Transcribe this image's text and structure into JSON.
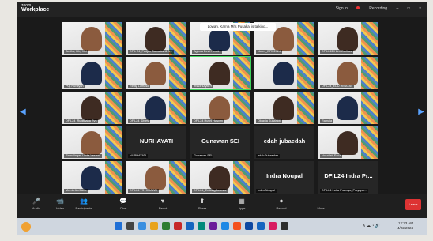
{
  "app": {
    "brand_small": "zoom",
    "brand_main": "Workplace"
  },
  "topbar": {
    "signin": "Sign in",
    "recording": "Recording"
  },
  "speaking_banner": "Lowan, Karna Mi's Pusakal is talking...",
  "tiles": [
    {
      "label": "Bertha, Liby Ltd",
      "type": "video"
    },
    {
      "label": "DFIL 24_Fadjan Tsanadamit A...",
      "type": "video"
    },
    {
      "label": "Aghnia Dewi Hendri",
      "type": "video"
    },
    {
      "label": "Nores_DFIL2024",
      "type": "video"
    },
    {
      "label": "DFIL2424 Leri Darlitas",
      "type": "video"
    },
    {
      "label": "Puji Nurdiyah",
      "type": "video"
    },
    {
      "label": "Rindy Lumaso",
      "type": "video"
    },
    {
      "label": "Irbadi sayid H",
      "type": "video"
    },
    {
      "label": "",
      "type": "video"
    },
    {
      "label": "DFIL24_EDU HISAYAT",
      "type": "video"
    },
    {
      "label": "DFIL24_Rugithaha Rvs",
      "type": "video"
    },
    {
      "label": "DFIL24_Diyes",
      "type": "video"
    },
    {
      "label": "DFIL24 Husni Hasyim",
      "type": "video"
    },
    {
      "label": "Oktavia Suharditi",
      "type": "video"
    },
    {
      "label": "Ramala",
      "type": "video"
    },
    {
      "label": "Ramalingan Unda Veslani",
      "type": "video"
    },
    {
      "label": "NURHAYATI",
      "type": "name",
      "name": "NURHAYATI"
    },
    {
      "label": "Gunawan SEI",
      "type": "name",
      "name": "Gunawan SEI"
    },
    {
      "label": "edah Jubaedah",
      "type": "name",
      "name": "edah jubaedah"
    },
    {
      "label": "Hoszifah Fariz",
      "type": "video"
    },
    {
      "label": "Merda Apriliana",
      "type": "video"
    },
    {
      "label": "DFIL24 TS HIMAWU",
      "type": "video"
    },
    {
      "label": "DFIL24_EndangSunavar",
      "type": "video"
    },
    {
      "label": "Indra Noupal",
      "type": "name",
      "name": "Indra Noupal"
    },
    {
      "label": "DFIL24 Indra Pranoya_Prayapa...",
      "type": "name",
      "name": "DFIL24 Indra Pr..."
    }
  ],
  "toolbar": [
    "Audio",
    "Video",
    "Participants",
    "Chat",
    "React",
    "Share",
    "Apps",
    "Record",
    "More"
  ],
  "leave_label": "Leave",
  "taskbar": {
    "time": "12:23 AM",
    "date": "4/22/2024"
  },
  "colors": {
    "accent": "#5aa3ff",
    "leave": "#d33333",
    "talk_outline": "#3cd35c"
  }
}
